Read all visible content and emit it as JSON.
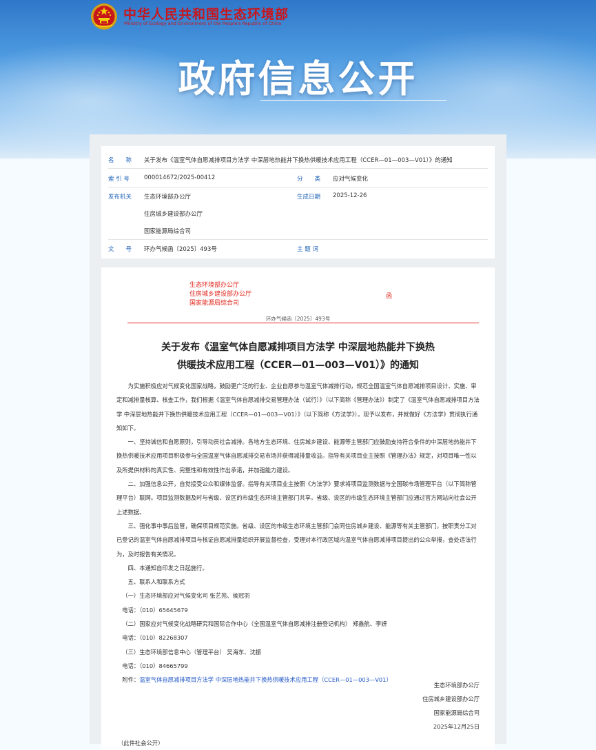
{
  "header": {
    "ministry_cn": "中华人民共和国生态环境部",
    "ministry_en": "Ministry of Ecology and Environment of the People's Republic of China",
    "banner_title": "政府信息公开"
  },
  "meta": {
    "name_label": "名　　称",
    "name_value": "关于发布《温室气体自愿减排项目方法学 中深层地热能井下换热供暖技术应用工程（CCER—01—003—V01）》的通知",
    "index_label": "索 引 号",
    "index_value": "000014672/2025-00412",
    "category_label": "分　　类",
    "category_value": "应对气候变化",
    "org_label": "发布机关",
    "org_values": [
      "生态环境部办公厅",
      "住房城乡建设部办公厅",
      "国家能源局综合司"
    ],
    "date_label": "生成日期",
    "date_value": "2025-12-26",
    "docno_label": "文　　号",
    "docno_value": "环办气候函〔2025〕493号",
    "topic_label": "主 题 词",
    "topic_value": ""
  },
  "doc": {
    "issuers": [
      "生态环境部办公厅",
      "住房城乡建设部办公厅",
      "国家能源局综合司"
    ],
    "han": "函",
    "doc_number": "环办气候函〔2025〕493号",
    "title_line1": "关于发布《温室气体自愿减排项目方法学 中深层地热能井下换热",
    "title_line2": "供暖技术应用工程（CCER—01—003—V01）》的通知",
    "paragraphs": [
      "为实施积极应对气候变化国家战略，鼓励更广泛的行业、企业自愿参与温室气体减排行动，规范全国温室气体自愿减排项目设计、实施、审定和减排量核算、核查工作，我们根据《温室气体自愿减排交易管理办法（试行）》（以下简称《管理办法》）制定了《温室气体自愿减排项目方法学 中深层地热能井下换热供暖技术应用工程（CCER—01—003—V01）》（以下简称《方法学》）。现予以发布，并就做好《方法学》贯彻执行通知如下。",
      "一、坚持诚信和自愿原则，引导动员社会减排。各地方生态环境、住房城乡建设、能源等主管部门应鼓励支持符合条件的中深层地热能井下换热供暖技术应用项目积极参与全国温室气体自愿减排交易市场并获得减排量收益。指导有关项目业主按照《管理办法》规定，对项目唯一性以及所提供材料的真实性、完整性和有效性作出承诺，并加强能力建设。",
      "二、加强信息公开，自觉接受公众和媒体监督。指导有关项目业主按照《方法学》要求将项目监测数据与全国碳市场管理平台（以下简称管理平台）联网。项目监测数据及时与省级、设区的市级生态环境主管部门共享。省级、设区的市级生态环境主管部门应通过官方网站向社会公开上述数据。",
      "三、强化事中事后监管，确保项目规范实施。省级、设区的市级生态环境主管部门会同住房城乡建设、能源等有关主管部门，按职责分工对已登记的温室气体自愿减排项目与核证自愿减排量组织开展监督检查，受理对本行政区域内温室气体自愿减排项目提出的公众举报，查处违法行为，及时报告有关情况。",
      "四、本通知自印发之日起施行。",
      "五、联系人和联系方式"
    ],
    "contacts": [
      {
        "org": "（一）生态环境部应对气候变化司 张艺苑、侯冠羽",
        "tel": "电话：（010）65645679"
      },
      {
        "org": "（二）国家应对气候变化战略研究和国际合作中心（全国温室气体自愿减排注册登记机构） 郑鑫航、李妍",
        "tel": "电话：（010）82268307"
      },
      {
        "org": "（三）生态环境部信息中心（管理平台） 吴海东、沈振",
        "tel": "电话：（010）84665799"
      }
    ],
    "attachment_label": "附件：",
    "attachment_link": "温室气体自愿减排项目方法学 中深层地热能井下换热供暖技术应用工程（CCER—01—003—V01）",
    "signers": [
      "生态环境部办公厅",
      "住房城乡建设部办公厅",
      "国家能源局综合司"
    ],
    "sign_date": "2025年12月25日",
    "disclosure": "（此件社会公开）"
  }
}
